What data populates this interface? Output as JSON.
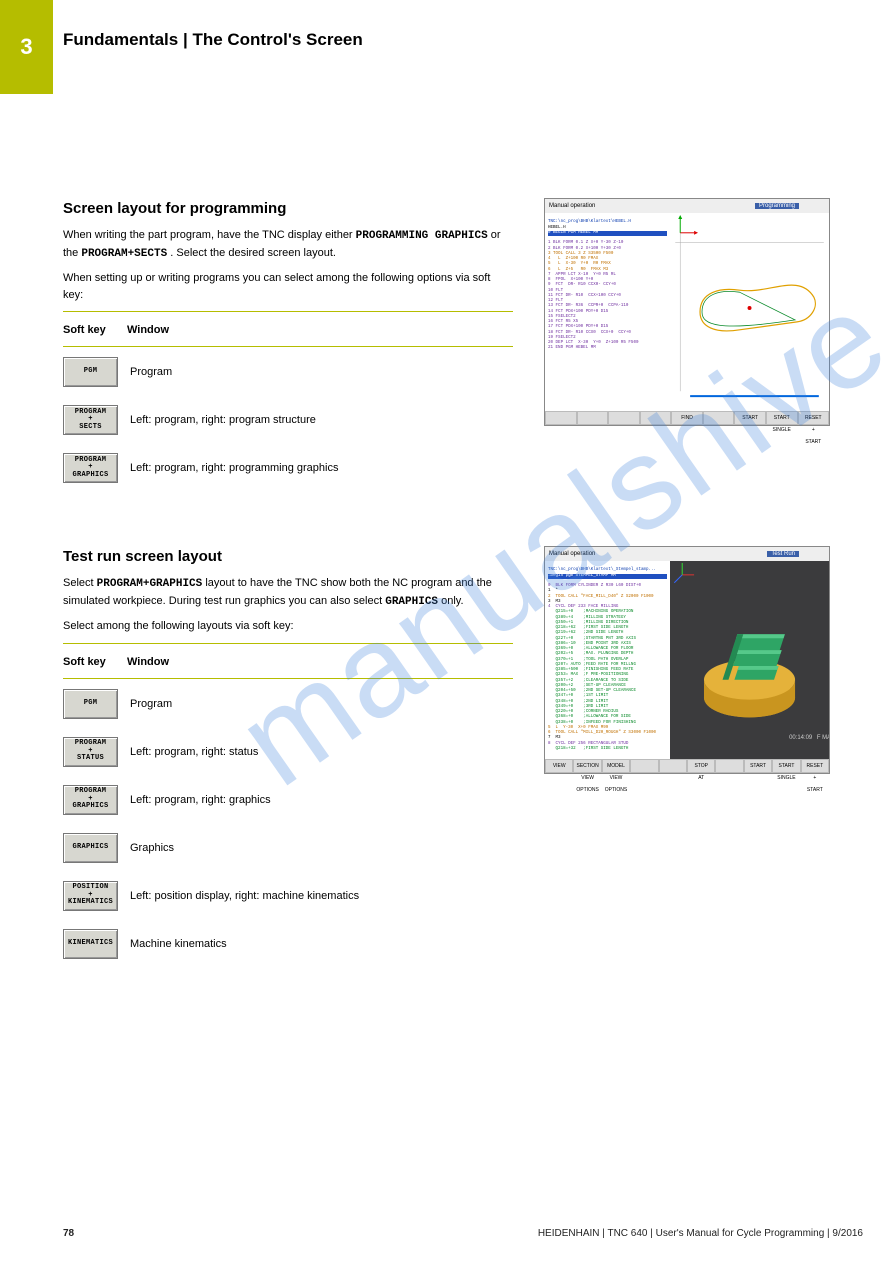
{
  "header": {
    "chapter_label": "3",
    "crumb": "Fundamentals | The Control's Screen"
  },
  "section1": {
    "title": "Screen layout for programming",
    "para1_prefix": "When writing the part program, have the TNC display either ",
    "kw1": "PROGRAMMING GRAPHICS",
    "para1_mid": " or the ",
    "kw2": "PROGRAM+SECTS",
    "para1_suffix": ". Select the desired screen layout.",
    "softkey_para": "When setting up or writing programs you can select among the following options via soft key:",
    "thead": {
      "c1": "Soft key",
      "c2": "Window"
    },
    "rows": [
      {
        "sk": "PGM",
        "meaning": "Program"
      },
      {
        "sk": "PROGRAM\n+\nSECTS",
        "meaning": "Left: program, right: program structure"
      },
      {
        "sk": "PROGRAM\n+\nGRAPHICS",
        "meaning": "Left: program, right: programming graphics"
      }
    ]
  },
  "section2": {
    "title": "Test run screen layout",
    "para1_prefix": "Select ",
    "para1_mid": " layout to have the TNC show both the NC program and the simulated workpiece. During test run graphics you can also select ",
    "kw1": "PROGRAM+GRAPHICS",
    "kw2": "GRAPHICS",
    "para1_suffix": " only.",
    "softkey_para": "Select among the following layouts via soft key:",
    "thead": {
      "c1": "Soft key",
      "c2": "Window"
    },
    "rows": [
      {
        "sk": "PGM",
        "meaning": "Program"
      },
      {
        "sk": "PROGRAM\n+\nSTATUS",
        "meaning": "Left: program, right: status"
      },
      {
        "sk": "PROGRAM\n+\nGRAPHICS",
        "meaning": "Left: program, right: graphics"
      },
      {
        "sk": "GRAPHICS",
        "meaning": "Graphics"
      },
      {
        "sk": "POSITION\n+\nKINEMATICS",
        "meaning": "Left: position display, right: machine kinematics"
      },
      {
        "sk": "KINEMATICS",
        "meaning": "Machine kinematics"
      }
    ]
  },
  "shots": {
    "s1": {
      "mode_left": "Manual operation",
      "mode_right": "Programming",
      "path": "TNC:\\nc_prog\\BHB\\Klartext\\HEBEL.H",
      "first": "HEBEL.H",
      "lines": [
        "0 BEGIN PGM HEBEL MM",
        "1 BLK FORM 0.1 Z X+0 Y-30 Z-10",
        "2 BLK FORM 0.2 X+100 Y+30 Z+0",
        "3 TOOL CALL 3 Z S3500 F500",
        "4   L  Z+100 R0 FMAX",
        "5   L  X-30  Y+0  R0 FMAX",
        "6   L  Z+5   R0  FMAX M3",
        "7  APPR LCT X-10  Y+0 R5 RL",
        "8  FPOL  X+100 Y+0",
        "9  FCT  DR- R10 CCX0- CCY+0",
        "10 FLT",
        "11 FCT DR- R10  CCX+100 CCY+0",
        "12 FLT",
        "13 FCT DR- R36  CCPR+0  CCPA-110",
        "14 FCT PDX+100 PDY+0 D15",
        "15 FSELECT2",
        "16 FCT R5 X5",
        "17 FCT PDX+100 PDY+0 D15",
        "18 FCT DR- R10 CCX0  CCX+0  CCY+0",
        "19 FSELECT2",
        "20 DEP LCT  X-30  Y+0  Z+100 R5 F500",
        "21 END PGM HEBEL MM"
      ],
      "sk": [
        "",
        "",
        "",
        "",
        "FIND",
        "",
        "START",
        "START\nSINGLE",
        "RESET\n+\nSTART"
      ]
    },
    "s2": {
      "mode_left": "Manual operation",
      "mode_right": "Test Run",
      "path": "TNC:\\nc_prog\\BHB\\Klartext\\_Stempel_stamp...",
      "first": "→begin pgm STEMPEL_STAMP MM",
      "lines": [
        "0  BLK FORM CYLINDER Z R30 L60 DIST+0",
        "1  *",
        "2  TOOL CALL \"FACE_MILL_D40\" Z S2000 F1000",
        "3  M3",
        "4  CYCL DEF 233 FACE MILLING",
        "   Q215=+0    ;MACHINING OPERATION",
        "   Q389=+4    ;MILLING STRATEGY",
        "   Q350=+1    ;MILLING DIRECTION",
        "   Q218=+62   ;FIRST SIDE LENGTH",
        "   Q219=+62   ;2ND SIDE LENGTH",
        "   Q227=+0    ;STARTNG PNT 3RD AXIS",
        "   Q386=-10   ;END POINT 3RD AXIS",
        "   Q369=+0    ;ALLOWANCE FOR FLOOR",
        "   Q202=+5    ;MAX. PLUNGING DEPTH",
        "   Q370=+1    ;TOOL PATH OVERLAP",
        "   Q207= AUTO ;FEED RATE FOR MILLNG",
        "   Q385=+500  ;FINISHING FEED RATE",
        "   Q253= MAX  ;F PRE-POSITIONING",
        "   Q357=+2    ;CLEARANCE TO SIDE",
        "   Q200=+2    ;SET-UP CLEARANCE",
        "   Q204=+50   ;2ND SET-UP CLEARANCE",
        "   Q347=+0    ;1ST LIMIT",
        "   Q348=+0    ;2ND LIMIT",
        "   Q349=+0    ;3RD LIMIT",
        "   Q220=+0    ;CORNER RADIUS",
        "   Q368=+0    ;ALLOWANCE FOR SIDE",
        "   Q338=+0    ;INFEED FOR FINISHING",
        "5  L  Y-30  X+0 FMAX M99",
        "6  TOOL CALL \"MILL_D20_ROUGH\" Z S3000 F1000",
        "7  M3",
        "8  CYCL DEF 256 RECTANGULAR STUD",
        "   Q218=+32   ;FIRST SIDE LENGTH"
      ],
      "time": "00:14:09",
      "sk": [
        "VIEW",
        "SECTION\nVIEW\nOPTIONS",
        "MODEL\nVIEW\nOPTIONS",
        "",
        "",
        "STOP\nAT",
        "",
        "START",
        "START\nSINGLE",
        "RESET\n+\nSTART"
      ]
    }
  },
  "footer": {
    "page": "78",
    "product": "HEIDENHAIN | TNC 640 | User's Manual for Cycle Programming | 9/2016"
  },
  "watermark": "manualshive.com"
}
